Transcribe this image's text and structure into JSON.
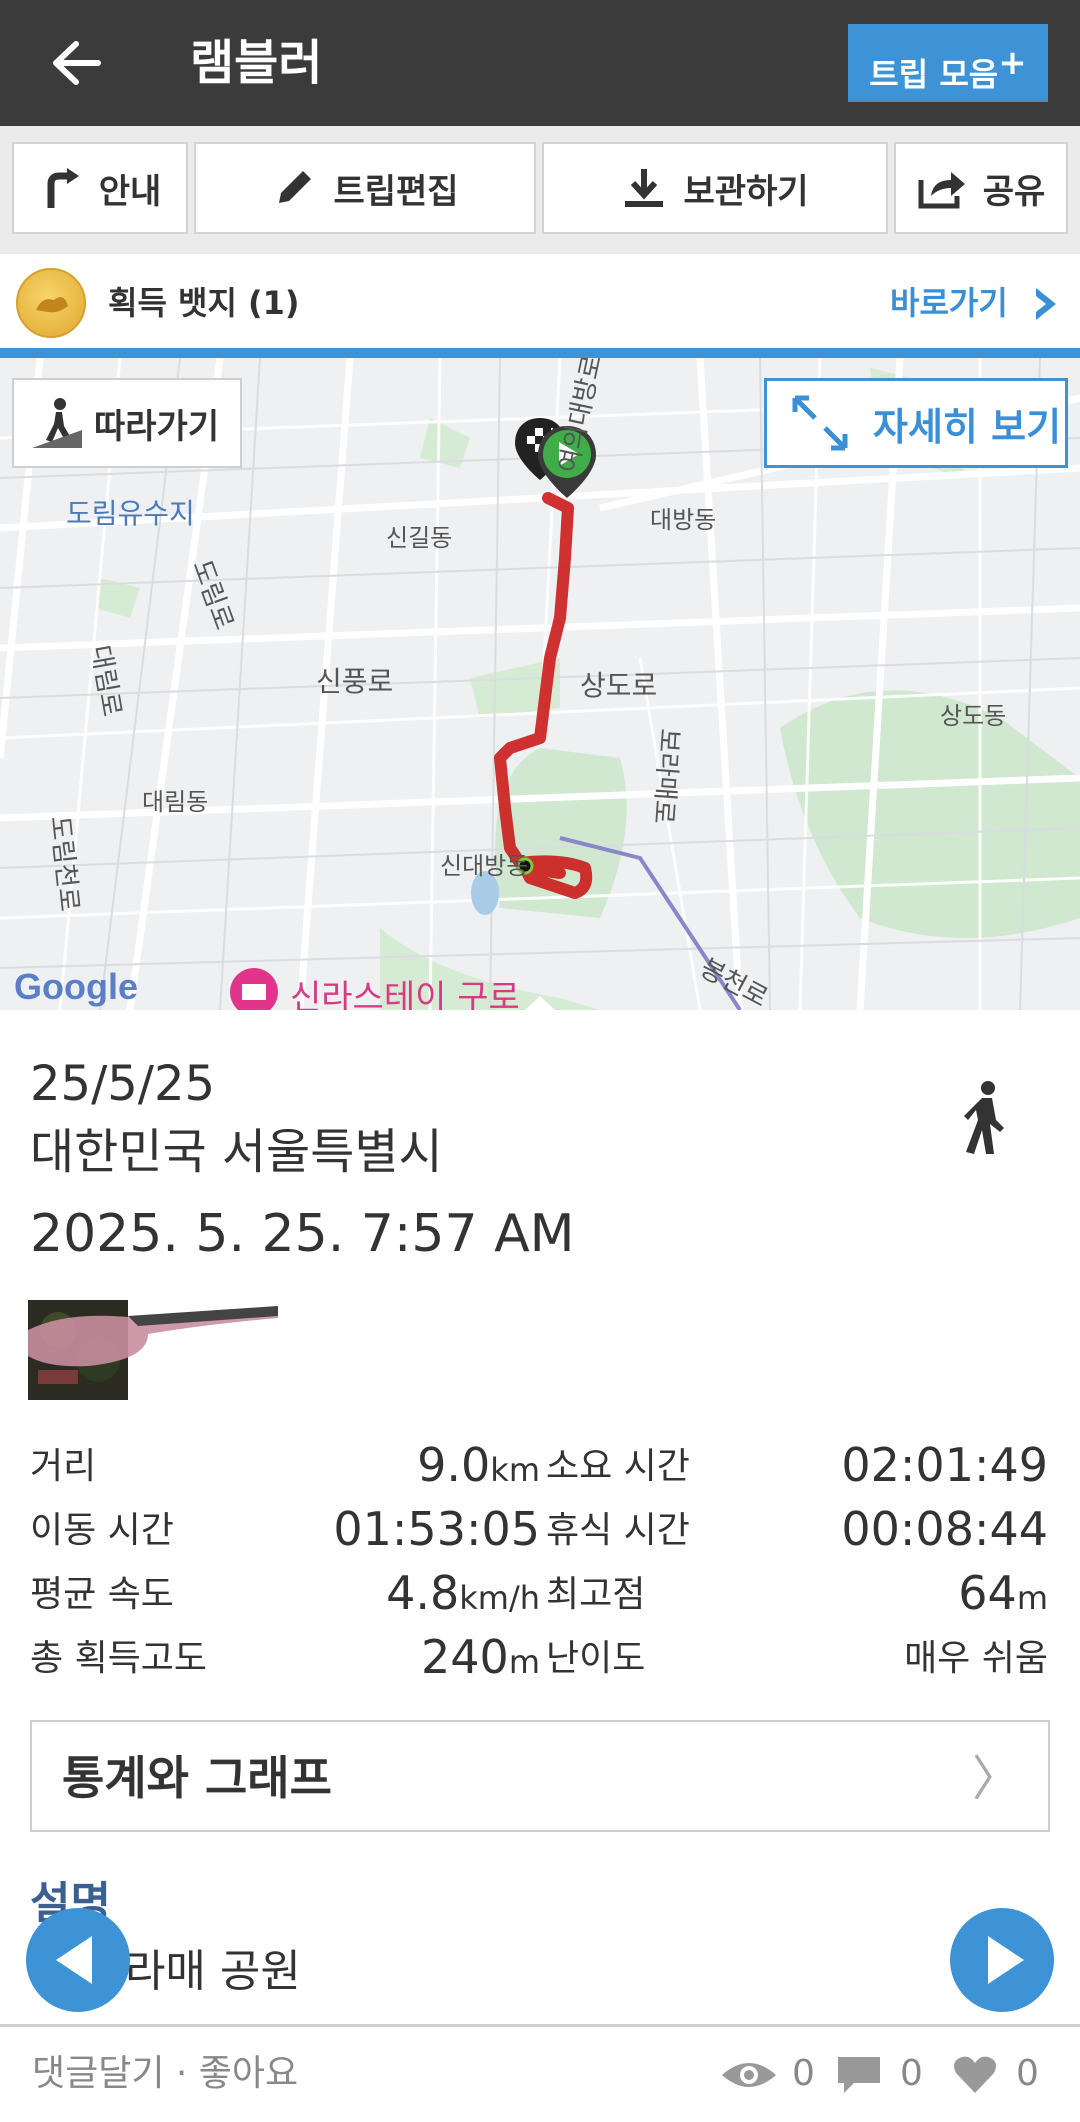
{
  "header": {
    "title": "램블러",
    "back_icon": "arrow-left-icon",
    "trip_collect_label": "트립 모음",
    "trip_collect_plus": "+"
  },
  "toolbar": {
    "guide_label": "안내",
    "edit_label": "트립편집",
    "save_label": "보관하기",
    "share_label": "공유"
  },
  "badge": {
    "label": "획득 뱃지 (1)",
    "goto_label": "바로가기"
  },
  "map": {
    "follow_label": "따라가기",
    "detail_label": "자세히 보기",
    "labels": {
      "dorim_reservoir": "도림유수지",
      "singil_dong": "신길동",
      "daebang_dong": "대방동",
      "yeouidaebang_ro": "여의대방로",
      "dorim_ro": "도림로",
      "singpung_ro": "신풍로",
      "sangdo_ro": "상도로",
      "sangdo_dong": "상도동",
      "daerim_ro": "대림로",
      "daerim_dong": "대림동",
      "boramae_ro": "보라매로",
      "sindaebang_dong": "신대방동",
      "dorimcheon_ro": "도림천로",
      "bongcheon_ro": "봉천로",
      "google": "Google",
      "shilla_stay": "신라스테이 구로"
    }
  },
  "trip": {
    "date": "25/5/25",
    "location": "대한민국 서울특별시",
    "datetime": "2025. 5. 25. 7:57 AM"
  },
  "stats": {
    "distance_label": "거리",
    "distance_value": "9.0",
    "distance_unit": "km",
    "elapsed_label": "소요 시간",
    "elapsed_value": "02:01:49",
    "moving_label": "이동 시간",
    "moving_value": "01:53:05",
    "rest_label": "휴식 시간",
    "rest_value": "00:08:44",
    "avg_speed_label": "평균 속도",
    "avg_speed_value": "4.8",
    "avg_speed_unit": "km/h",
    "max_alt_label": "최고점",
    "max_alt_value": "64",
    "max_alt_unit": "m",
    "gain_label": "총 획득고도",
    "gain_value": "240",
    "gain_unit": "m",
    "difficulty_label": "난이도",
    "difficulty_value": "매우 쉬움"
  },
  "stats_button": {
    "label": "통계와 그래프",
    "chevron": "〉"
  },
  "description": {
    "heading": "설명",
    "text": "관 보라매 공원"
  },
  "footer": {
    "links": "댓글달기 · 좋아요",
    "views": "0",
    "comments": "0",
    "likes": "0"
  },
  "colors": {
    "header_bg": "#3b3b3b",
    "accent": "#3d93d6",
    "route": "#cc2020"
  }
}
